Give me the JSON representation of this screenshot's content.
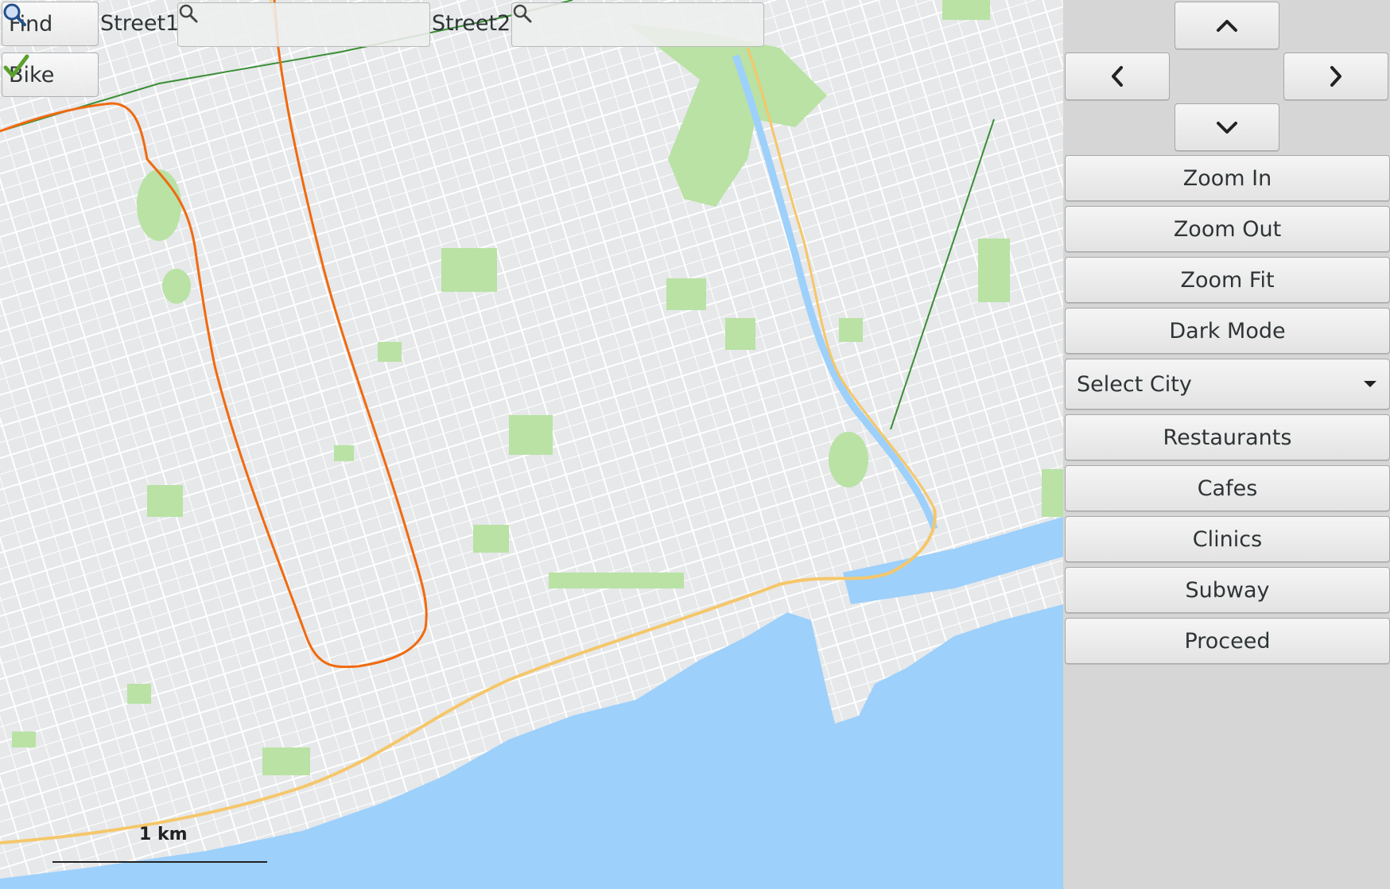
{
  "toolbar": {
    "find_label": "Find",
    "street1_label": "Street1",
    "street1_value": "",
    "street2_label": "Street2",
    "street2_value": "",
    "bike_label": "Bike",
    "bike_checked": true
  },
  "map": {
    "scale_label": "1 km",
    "colors": {
      "land": "#e6e8ea",
      "park": "#b9e2a4",
      "water": "#9dd0fb",
      "street": "#ffffff",
      "highway": "#f5c76a",
      "route": "#f06a10",
      "rail": "#3a8f34"
    }
  },
  "panel": {
    "pan_up_icon": "chevron-up-icon",
    "pan_left_icon": "chevron-left-icon",
    "pan_right_icon": "chevron-right-icon",
    "pan_down_icon": "chevron-down-icon",
    "zoom_in": "Zoom In",
    "zoom_out": "Zoom Out",
    "zoom_fit": "Zoom Fit",
    "dark_mode": "Dark Mode",
    "select_city": "Select City",
    "restaurants": "Restaurants",
    "cafes": "Cafes",
    "clinics": "Clinics",
    "subway": "Subway",
    "proceed": "Proceed"
  }
}
